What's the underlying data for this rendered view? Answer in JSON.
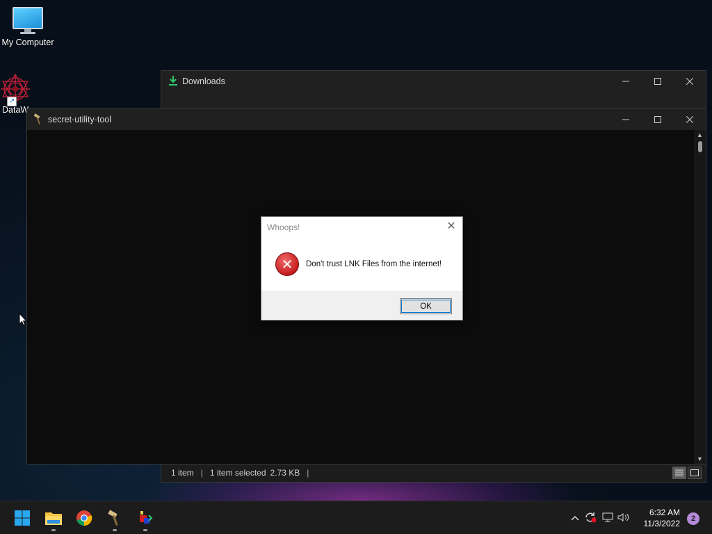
{
  "desktop": {
    "icons": [
      {
        "label": "My Computer"
      },
      {
        "label": "DataW"
      }
    ]
  },
  "downloads_window": {
    "title": "Downloads",
    "status": {
      "items": "1 item",
      "selected": "1 item selected",
      "size": "2.73 KB"
    }
  },
  "secret_window": {
    "title": "secret-utility-tool"
  },
  "dialog": {
    "title": "Whoops!",
    "message": "Don't trust LNK Files from the internet!",
    "ok_label": "OK"
  },
  "taskbar": {
    "time": "6:32 AM",
    "date": "11/3/2022",
    "notification_count": "2"
  },
  "colors": {
    "error_red": "#c51d1d",
    "downloads_icon_green": "#2ecc71",
    "notif_badge": "#b48ad8"
  }
}
